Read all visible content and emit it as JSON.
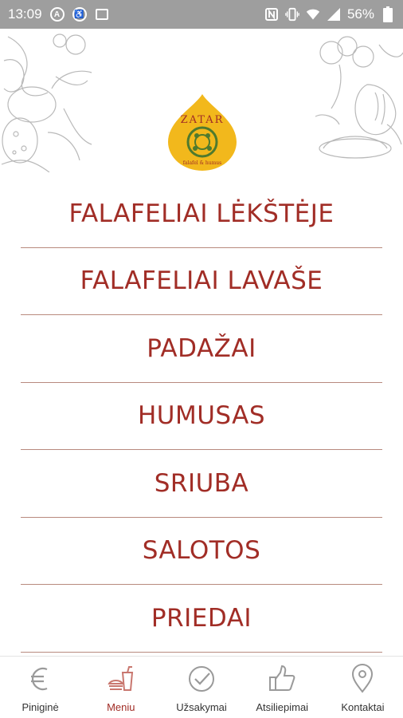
{
  "status_bar": {
    "time": "13:09",
    "battery": "56%",
    "icons": [
      "a-circle-icon",
      "accessibility-icon",
      "image-icon",
      "nfc-icon",
      "vibrate-icon",
      "wifi-icon",
      "signal-icon",
      "battery-icon"
    ]
  },
  "brand": {
    "logo_text": "ZATAR",
    "logo_subtext": "falafel & humus",
    "accent": "#a12d26",
    "logo_color": "#f2b81c"
  },
  "menu": {
    "items": [
      {
        "label": "FALAFELIAI LĖKŠTĖJE"
      },
      {
        "label": "FALAFELIAI LAVAŠE"
      },
      {
        "label": "PADAŽAI"
      },
      {
        "label": "HUMUSAS"
      },
      {
        "label": "SRIUBA"
      },
      {
        "label": "SALOTOS"
      },
      {
        "label": "PRIEDAI"
      }
    ]
  },
  "bottom_nav": {
    "active": "Meniu",
    "items": [
      {
        "label": "Piniginė",
        "icon": "euro-icon"
      },
      {
        "label": "Meniu",
        "icon": "food-drink-icon"
      },
      {
        "label": "Užsakymai",
        "icon": "check-badge-icon"
      },
      {
        "label": "Atsiliepimai",
        "icon": "thumbs-up-icon"
      },
      {
        "label": "Kontaktai",
        "icon": "location-pin-icon"
      }
    ]
  }
}
